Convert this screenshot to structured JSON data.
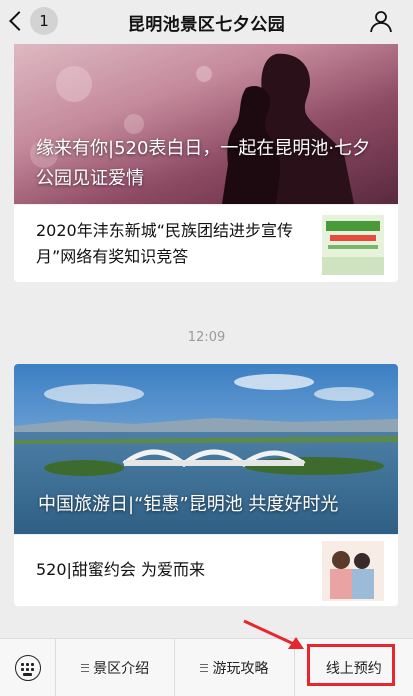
{
  "header": {
    "back_count": "1",
    "title": "昆明池景区七夕公园"
  },
  "feed": {
    "card1": {
      "hero_title": "缘来有你|520表白日，一起在昆明池·七夕公园见证爱情",
      "item_text": "2020年沣东新城“民族团结进步宣传月”网络有奖知识竞答"
    },
    "time": "12:09",
    "card2": {
      "hero_title": "中国旅游日|“钜惠”昆明池 共度好时光",
      "item_text": "520|甜蜜约会 为爱而来"
    }
  },
  "bottom_menu": {
    "items": [
      "景区介绍",
      "游玩攻略",
      "线上预约"
    ]
  },
  "colors": {
    "highlight": "#e8262d",
    "background": "#ededed"
  }
}
